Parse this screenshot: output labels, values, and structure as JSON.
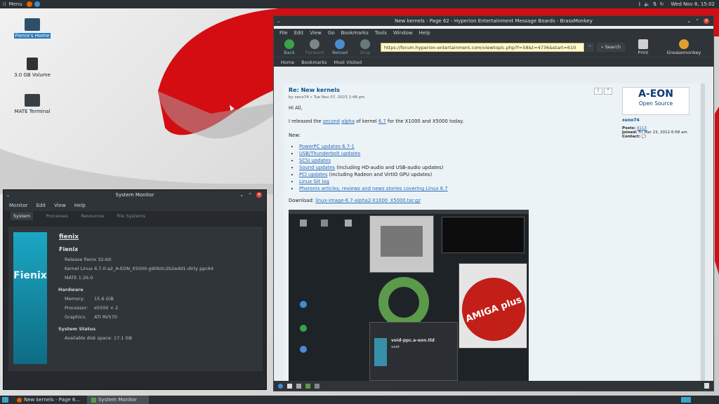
{
  "topbar": {
    "menu_label": "Menu",
    "clock": "Wed Nov 8, 15:02"
  },
  "desktop": {
    "icons": [
      {
        "label": "Fienix's Home"
      },
      {
        "label": "3.0 GB Volume"
      },
      {
        "label": "MATE Terminal"
      }
    ]
  },
  "browser": {
    "title": "New kernels - Page 62 - Hyperion Entertainment Message Boards - BrassMonkey",
    "menu": [
      "File",
      "Edit",
      "View",
      "Go",
      "Bookmarks",
      "Tools",
      "Window",
      "Help"
    ],
    "toolbar": {
      "back": "Back",
      "forward": "Forward",
      "reload": "Reload",
      "stop": "Stop",
      "search": "Search",
      "print": "Print",
      "greasemonkey": "Greasemonkey"
    },
    "url": "https://forum.hyperion-entertainment.com/viewtopic.php?f=58&t=4736&start=610",
    "bookmarks": [
      "Home",
      "Bookmarks",
      "Most Visited"
    ],
    "post": {
      "title": "Re: New kernels",
      "byline": "by xeno74 » Tue Nov 07, 2023 2:48 pm",
      "greeting": "Hi All,",
      "intro_prefix": "I released the ",
      "intro_second": "second",
      "intro_alpha": "alpha",
      "intro_mid": " of kernel ",
      "intro_ver": "6.7",
      "intro_suffix": " for the X1000 and X5000 today.",
      "new_label": "New:",
      "items": [
        {
          "link": "PowerPC updates 6.7-1",
          "rest": ""
        },
        {
          "link": "USB/Thunderbolt updates",
          "rest": ""
        },
        {
          "link": "SCSI updates",
          "rest": ""
        },
        {
          "link": "Sound updates",
          "rest": " (including HD-audio and USB-audio updates)"
        },
        {
          "link": "PCI updates",
          "rest": " (including Radeon and VirtIO GPU updates)"
        },
        {
          "link": "Linux Git log",
          "rest": ""
        },
        {
          "link": "Phoronix articles, reviews and news stories covering Linux 6.7",
          "rest": ""
        }
      ],
      "download_label": "Download: ",
      "download_link": "linux-image-6.7-alpha2-X1000_X5000.tar.gz"
    },
    "profile": {
      "logo_line1": "A-EON",
      "logo_line2": "Open Source",
      "username": "xeno74",
      "posts_label": "Posts:",
      "posts": "9113",
      "joined_label": "Joined:",
      "joined": "Fri Mar 23, 2012 6:58 am",
      "contact_label": "Contact:"
    },
    "embedded": {
      "amiga_text": "AMIGA plus",
      "panel_title": "void-ppc.a-eon.tld",
      "panel_sub": "void"
    }
  },
  "sysmon": {
    "title": "System Monitor",
    "menu": [
      "Monitor",
      "Edit",
      "View",
      "Help"
    ],
    "tabs": [
      "System",
      "Processes",
      "Resources",
      "File Systems"
    ],
    "logo_text": "Fienix",
    "hostname": "fienix",
    "os_name": "Fienix",
    "release": "Release fienix 32-bit",
    "kernel": "Kernel Linux 6.7.0-a2_A-EON_X5000-g90b0c2b2edd1-dirty ppc64",
    "mate": "MATE 1.26.0",
    "hw_label": "Hardware",
    "memory_label": "Memory:",
    "memory": "15.6 GiB",
    "proc_label": "Processor:",
    "proc": "e5500 × 2",
    "gfx_label": "Graphics:",
    "gfx": "ATI RV570",
    "status_label": "System Status",
    "disk_label": "Available disk space:",
    "disk": "17.1 GB"
  },
  "taskbar": {
    "items": [
      "New kernels - Page 6...",
      "System Monitor"
    ]
  }
}
